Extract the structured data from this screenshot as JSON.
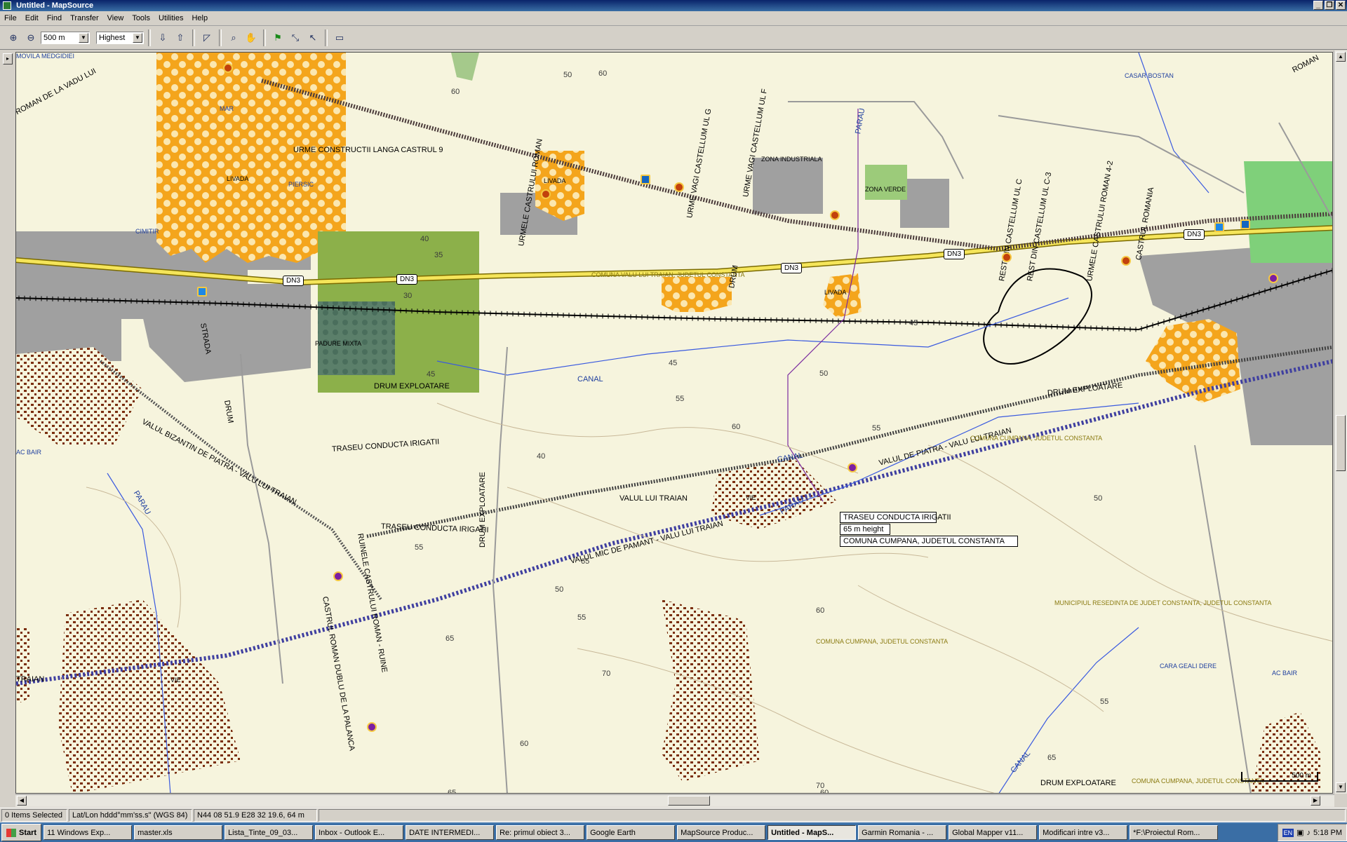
{
  "window": {
    "title": "Untitled - MapSource"
  },
  "menu": [
    "File",
    "Edit",
    "Find",
    "Transfer",
    "View",
    "Tools",
    "Utilities",
    "Help"
  ],
  "toolbar": {
    "zoom_level": "500 m",
    "detail": "Highest",
    "icons": [
      "zoom-in-icon",
      "zoom-out-icon",
      "receive-from-device-icon",
      "send-to-device-icon",
      "map-tool-icon",
      "zoom-tool-icon",
      "hand-tool-icon",
      "waypoint-tool-icon",
      "route-tool-icon",
      "selection-tool-icon",
      "distance-tool-icon"
    ]
  },
  "map": {
    "roads": [
      {
        "label": "DN3"
      },
      {
        "label": "DN3"
      },
      {
        "label": "DN3"
      },
      {
        "label": "DN3"
      },
      {
        "label": "DN3"
      }
    ],
    "labels": [
      "VALUL LUI TRAIAN",
      "LIVADA",
      "LIVADA",
      "LIVADA",
      "PADURE MIXTA",
      "DRUM EXPLOATARE",
      "CANAL",
      "CANAL",
      "TRASEU CONDUCTA IRIGATII",
      "TRASEU CONDUCTA IRIGATII",
      "URME CONSTRUCTII LANGA CASTRUL 9",
      "ZONA INDUSTRIALA",
      "ZONA VERDE",
      "VALUL MIC DE PAMANT - VALU LUI TRAIAN",
      "VALUL DE PIATRA - VALU LUI TRAIAN",
      "DRUM EXPLOATARE",
      "VIE",
      "VIE",
      "PARAU",
      "PARAU",
      "CASTRUL ROMAN DUBLU DE LA PALANCA",
      "COMUNA CUMPANA, JUDETUL CONSTANTA",
      "COMUNA CUMPANA, JUDETUL CONSTANTA",
      "COMUNA CUMPANA, JUDETUL CONSTANTA",
      "MUNICIPIUL RESEDINTA DE JUDET CONSTANTA, JUDETUL CONSTANTA",
      "COMUNA VALU LUI TRAIAN, JUDETUL CONSTANTA",
      "CASAR BOSTAN",
      "CARA GEALI DERE",
      "MOVILA MEDGIDIEI",
      "AC BAIR",
      "CIMITIR",
      "MAR",
      "PIERSIC",
      "VALUL BIZANTIN DE PIATRA - VALU LUI TRAIAN",
      "DRUM",
      "DRUM",
      "STRADA",
      "RUINELE CASTRULUI ROMAN - RUINE",
      "URME VAGI CASTELLUM UL G",
      "DRUM EXPLOATARE",
      "CASTRUL ROMANIA",
      "REST DIN CASTELLUM UL C",
      "REST DIN CASTELLUM UL C-3",
      "URMELE CASTRULUI ROMAN 4-2",
      "AC BAIR",
      "PARAU",
      "ROMAN DE LA VADU LUI",
      "ROMAN",
      "TRAIAN",
      "CANAL",
      "DRUM EXPLOATARE",
      "URMELE CASTRULUI ROMAN",
      "URME VAGI CASTELLUM UL F"
    ],
    "contours": [
      "60",
      "50",
      "60",
      "40",
      "35",
      "30",
      "45",
      "45",
      "50",
      "55",
      "60",
      "55",
      "45",
      "40",
      "65",
      "60",
      "65",
      "70",
      "60",
      "50",
      "55",
      "65",
      "55",
      "50",
      "60",
      "70",
      "65",
      "55"
    ],
    "tooltip": {
      "line1": "TRASEU CONDUCTA IRIGATII",
      "line2": "65 m height",
      "line3": "COMUNA CUMPANA, JUDETUL CONSTANTA"
    },
    "scale": "500 m"
  },
  "status": {
    "selected": "0 Items Selected",
    "format": "Lat/Lon hddd°mm'ss.s\" (WGS 84)",
    "position": "N44 08 51.9 E28 32 19.6, 64 m"
  },
  "taskbar": {
    "start": "Start",
    "items": [
      {
        "label": "11 Windows Exp...",
        "active": false
      },
      {
        "label": "master.xls",
        "active": false
      },
      {
        "label": "Lista_Tinte_09_03...",
        "active": false
      },
      {
        "label": "Inbox - Outlook E...",
        "active": false
      },
      {
        "label": "DATE INTERMEDI...",
        "active": false
      },
      {
        "label": "Re: primul obiect 3...",
        "active": false
      },
      {
        "label": "Google Earth",
        "active": false
      },
      {
        "label": "MapSource Produc...",
        "active": false
      },
      {
        "label": "Untitled - MapS...",
        "active": true
      },
      {
        "label": "Garmin Romania - ...",
        "active": false
      },
      {
        "label": "Global Mapper v11...",
        "active": false
      },
      {
        "label": "Modificari intre v3...",
        "active": false
      },
      {
        "label": "*F:\\Proiectul Rom...",
        "active": false
      }
    ],
    "language": "EN",
    "clock": "5:18 PM"
  }
}
